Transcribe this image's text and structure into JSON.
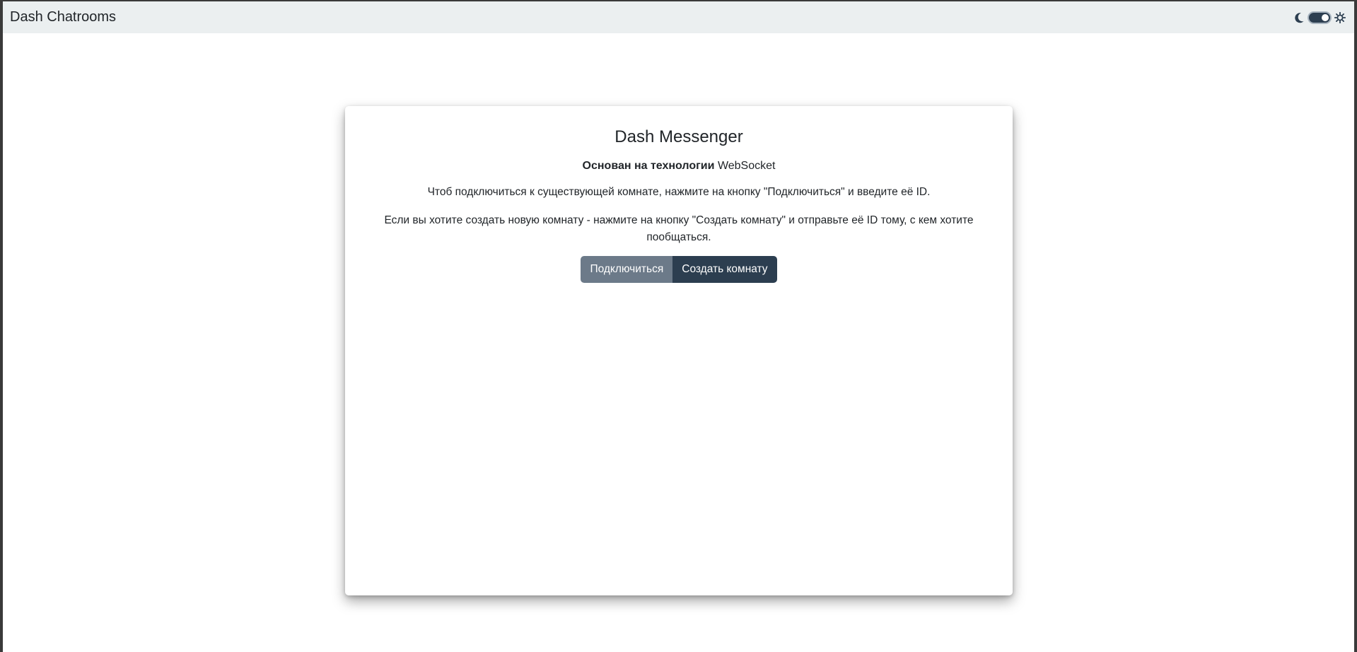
{
  "navbar": {
    "brand": "Dash Chatrooms",
    "theme": {
      "moon_icon": "moon-icon",
      "sun_icon": "sun-icon",
      "dark_mode_on": true
    }
  },
  "card": {
    "title": "Dash Messenger",
    "tech_bold": "Основан на технологии",
    "tech_name": "WebSocket",
    "para1": "Чтоб подключиться к существующей комнате, нажмите на кнопку \"Подключиться\" и введите её ID.",
    "para2": "Если вы хотите создать новую комнату - нажмите на кнопку \"Создать комнату\" и отправьте её ID тому, с кем хотите пообщаться.",
    "buttons": {
      "connect": "Подключиться",
      "create": "Создать комнату"
    }
  },
  "colors": {
    "navbar_bg": "#ebeff0",
    "primary": "#2c3e50",
    "secondary": "#6c7a89"
  }
}
